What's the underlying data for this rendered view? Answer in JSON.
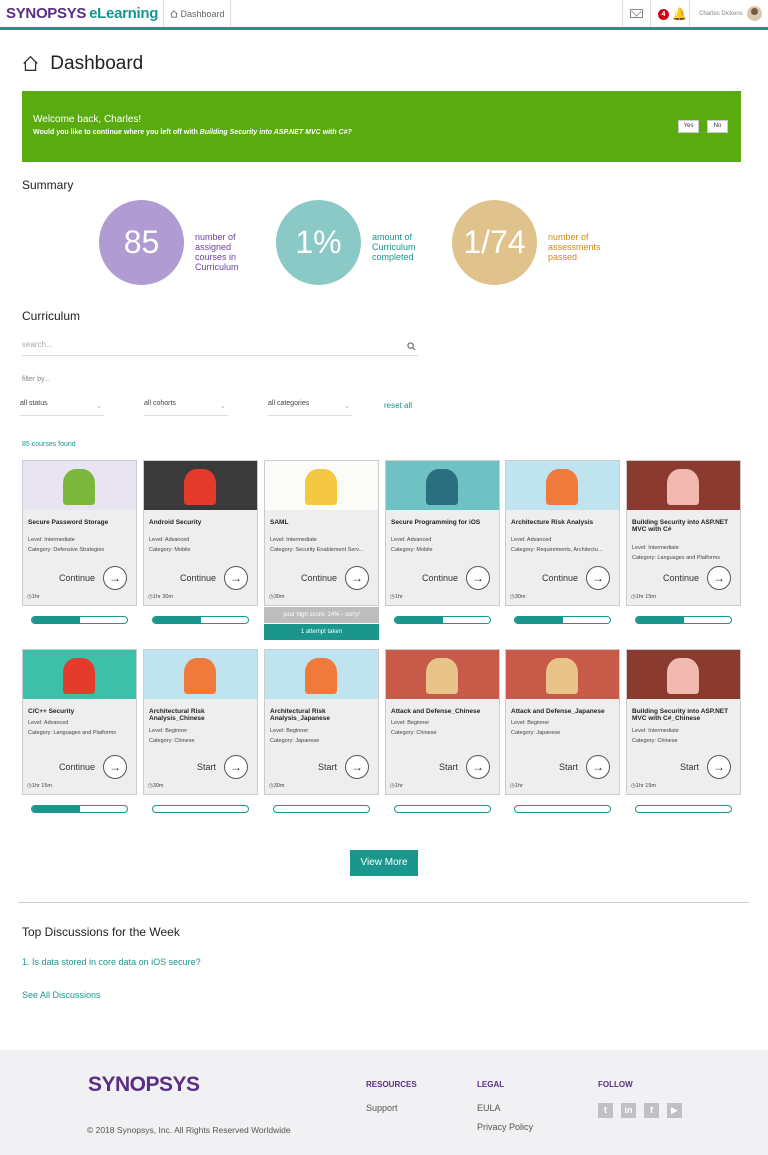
{
  "header": {
    "brand": "SYNOPSYS",
    "brand_suffix": "eLearning",
    "nav_dashboard": "Dashboard",
    "notification_count": "4",
    "user_name": "Charles Dickens"
  },
  "page": {
    "title": "Dashboard"
  },
  "welcome": {
    "greeting": "Welcome back, Charles!",
    "question_prefix": "Would you like to continue where you left off with ",
    "course": "Building Security into ASP.NET MVC with C#?",
    "yes": "Yes",
    "no": "No",
    "color": "#5aab0f"
  },
  "summary": {
    "heading": "Summary",
    "stats": [
      {
        "value": "85",
        "label": "number of assigned courses in Curriculum",
        "color": "#b09bd2"
      },
      {
        "value": "1%",
        "label": "amount of Curriculum completed",
        "color": "#8ac9c5"
      },
      {
        "value": "1/74",
        "label": "number of assessments passed",
        "color": "#e0c28c"
      }
    ]
  },
  "curriculum": {
    "heading": "Curriculum",
    "search_placeholder": "search...",
    "filter_by": "filter by...",
    "filters": [
      "all status",
      "all cohorts",
      "all categories"
    ],
    "reset": "reset all",
    "found": "85 courses found",
    "courses": [
      {
        "title": "Secure Password Storage",
        "level": "Level: Intermediate",
        "category": "Category: Defensive Strategies",
        "action": "Continue",
        "duration": "1hr",
        "progress": 0.5
      },
      {
        "title": "Android Security",
        "level": "Level: Advanced",
        "category": "Category: Mobile",
        "action": "Continue",
        "duration": "1hr 30m",
        "progress": 0.5
      },
      {
        "title": "SAML",
        "level": "Level: Intermediate",
        "category": "Category: Security Enablement Serv...",
        "action": "Continue",
        "duration": "30m",
        "high_score": "your high score: 14% - sorry!",
        "attempts": "1 attempt taken"
      },
      {
        "title": "Secure Programming for iOS",
        "level": "Level: Advanced",
        "category": "Category: Mobile",
        "action": "Continue",
        "duration": "1hr",
        "progress": 0.5
      },
      {
        "title": "Architecture Risk Analysis",
        "level": "Level: Advanced",
        "category": "Category: Requirements, Architectu...",
        "action": "Continue",
        "duration": "30m",
        "progress": 0.5
      },
      {
        "title": "Building Security into ASP.NET MVC with C#",
        "level": "Level: Intermediate",
        "category": "Category: Languages and Platforms",
        "action": "Continue",
        "duration": "1hr 15m",
        "progress": 0.5
      },
      {
        "title": "C/C++ Security",
        "level": "Level: Advanced",
        "category": "Category: Languages and Platforms",
        "action": "Continue",
        "duration": "1hr 15m",
        "progress": 0.5
      },
      {
        "title": "Architectural Risk Analysis_Chinese",
        "level": "Level: Beginner",
        "category": "Category: Chinese",
        "action": "Start",
        "duration": "30m",
        "progress": 0
      },
      {
        "title": "Architectural Risk Analysis_Japanese",
        "level": "Level: Beginner",
        "category": "Category: Japanese",
        "action": "Start",
        "duration": "30m",
        "progress": 0
      },
      {
        "title": "Attack and Defense_Chinese",
        "level": "Level: Beginner",
        "category": "Category: Chinese",
        "action": "Start",
        "duration": "1hr",
        "progress": 0
      },
      {
        "title": "Attack and Defense_Japanese",
        "level": "Level: Beginner",
        "category": "Category: Japanese",
        "action": "Start",
        "duration": "1hr",
        "progress": 0
      },
      {
        "title": "Building Security into ASP.NET MVC with C#_Chinese",
        "level": "Level: Intermediate",
        "category": "Category: Chinese",
        "action": "Start",
        "duration": "1hr 15m",
        "progress": 0
      }
    ],
    "view_more": "View More"
  },
  "discussions": {
    "heading": "Top Discussions for the Week",
    "items": [
      "1. Is data stored in core data on iOS secure?"
    ],
    "see_all": "See All Discussions"
  },
  "footer": {
    "logo": "SYNOPSYS",
    "copyright": "© 2018 Synopsys, Inc. All Rights Reserved Worldwide",
    "resources": "RESOURCES",
    "support": "Support",
    "legal": "LEGAL",
    "eula": "EULA",
    "privacy": "Privacy Policy",
    "follow": "FOLLOW"
  }
}
